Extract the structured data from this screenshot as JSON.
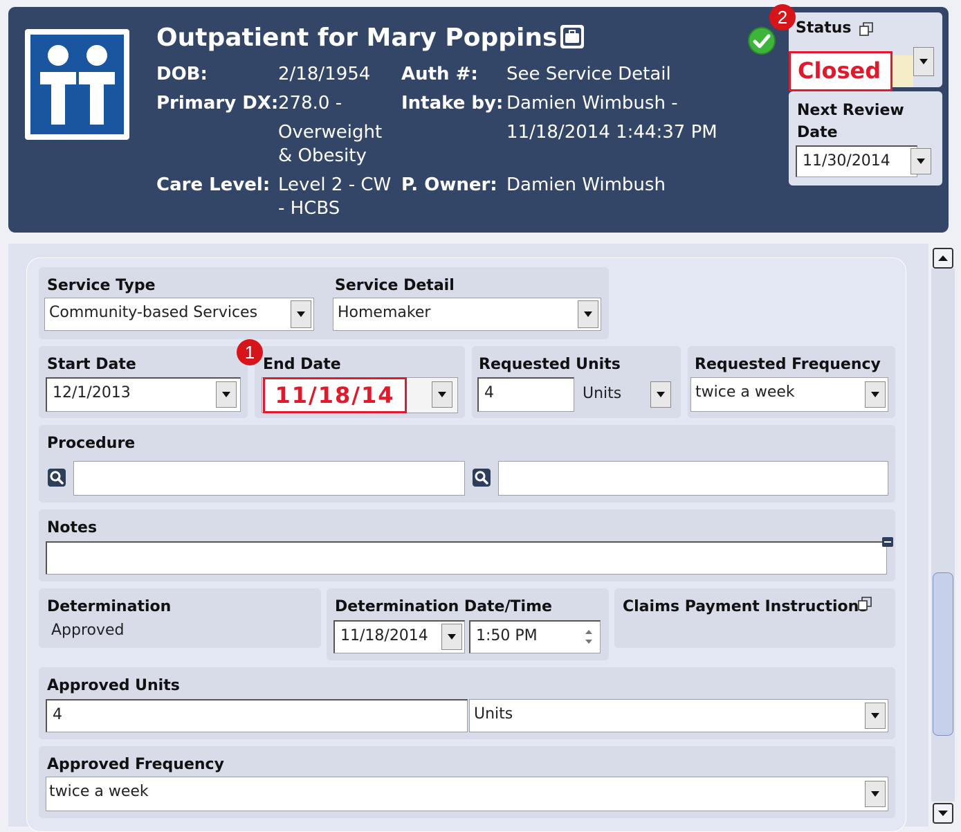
{
  "header": {
    "title": "Outpatient for Mary Poppins",
    "dob_label": "DOB:",
    "dob_value": "2/18/1954",
    "auth_label": "Auth #:",
    "auth_value": "See Service Detail",
    "primary_dx_label": "Primary DX:",
    "primary_dx_value_1": "278.0 -",
    "primary_dx_value_2": "Overweight",
    "primary_dx_value_3": "& Obesity",
    "intake_label": "Intake by:",
    "intake_value_1": "Damien Wimbush -",
    "intake_value_2": "11/18/2014 1:44:37 PM",
    "care_level_label": "Care Level:",
    "care_level_value_1": "Level 2 - CW",
    "care_level_value_2": "- HCBS",
    "owner_label": "P. Owner:",
    "owner_value": "Damien Wimbush"
  },
  "status": {
    "label": "Status",
    "value": "Closed",
    "badge": "2"
  },
  "next_review": {
    "label_1": "Next Review",
    "label_2": "Date",
    "value": "11/30/2014"
  },
  "form": {
    "service_type": {
      "label": "Service Type",
      "value": "Community-based Services"
    },
    "service_detail": {
      "label": "Service Detail",
      "value": "Homemaker"
    },
    "start_date": {
      "label": "Start Date",
      "value": "12/1/2013"
    },
    "end_date": {
      "label": "End Date",
      "value": "11/18/14",
      "badge": "1"
    },
    "requested_units": {
      "label": "Requested Units",
      "value": "4",
      "unit": "Units"
    },
    "requested_frequency": {
      "label": "Requested Frequency",
      "value": "twice a week"
    },
    "procedure": {
      "label": "Procedure",
      "value_1": "",
      "value_2": ""
    },
    "notes": {
      "label": "Notes",
      "value": ""
    },
    "determination": {
      "label": "Determination",
      "value": "Approved"
    },
    "determination_datetime": {
      "label": "Determination Date/Time",
      "date": "11/18/2014",
      "time": "1:50 PM"
    },
    "claims_payment": {
      "label": "Claims Payment Instructions"
    },
    "approved_units": {
      "label": "Approved Units",
      "value": "4",
      "unit": "Units"
    },
    "approved_frequency": {
      "label": "Approved Frequency",
      "value": "twice a week"
    }
  },
  "colors": {
    "header_bg": "#334668",
    "highlight_red": "#e2182b",
    "badge_red": "#d7141a",
    "logo_blue": "#1a55a0"
  },
  "icons": [
    "briefcase-icon",
    "check-circle-icon",
    "copy-icon",
    "search-icon",
    "dropdown-arrow-icon",
    "collapse-icon",
    "scroll-up-icon",
    "scroll-down-icon"
  ]
}
